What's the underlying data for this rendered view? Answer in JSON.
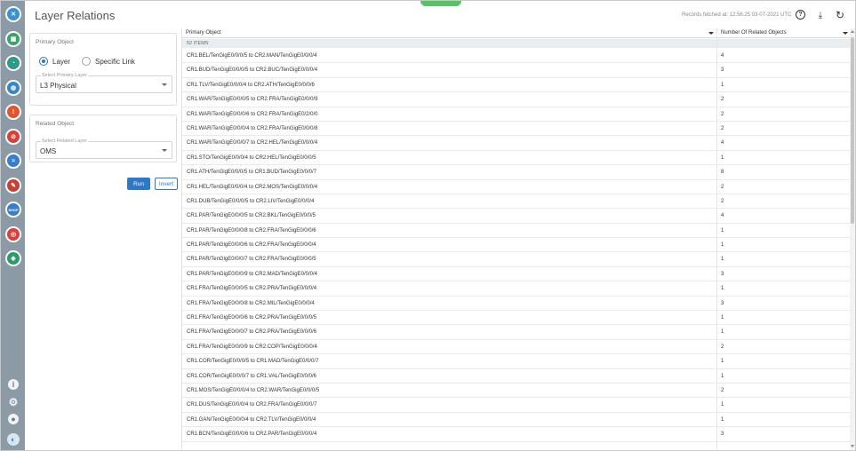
{
  "header": {
    "title": "Layer Relations",
    "records_fetched": "Records fetched at: 12:56:25 03-07-2021 UTC"
  },
  "rail_icons": [
    {
      "name": "logo-icon",
      "color": "#3a8fd6",
      "glyph": "✕"
    },
    {
      "name": "document-icon",
      "color": "#3aa36b",
      "glyph": "▣"
    },
    {
      "name": "gauge-icon",
      "color": "#2d9a8a",
      "glyph": "◔"
    },
    {
      "name": "globe-icon",
      "color": "#3a84c8",
      "glyph": "◍"
    },
    {
      "name": "alert-icon",
      "color": "#e0552e",
      "glyph": "!"
    },
    {
      "name": "no-entry-icon",
      "color": "#d8403a",
      "glyph": "⊘"
    },
    {
      "name": "wave-icon",
      "color": "#3a7dc8",
      "glyph": "≈"
    },
    {
      "name": "tools-icon",
      "color": "#c8403a",
      "glyph": "✎"
    },
    {
      "name": "shop-icon",
      "color": "#3a7dc8",
      "glyph": "SHOP"
    },
    {
      "name": "radar-icon",
      "color": "#d8403a",
      "glyph": "◎"
    },
    {
      "name": "layers-icon",
      "color": "#2d9a6b",
      "glyph": "◈"
    }
  ],
  "primary_panel": {
    "title": "Primary Object",
    "option_layer": "Layer",
    "option_link": "Specific Link",
    "select_label": "Select Primary Layer",
    "select_value": "L3 Physical"
  },
  "related_panel": {
    "title": "Related Object",
    "select_label": "Select Related Layer",
    "select_value": "OMS"
  },
  "buttons": {
    "run": "Run",
    "invert": "Invert"
  },
  "table": {
    "col_primary": "Primary Object",
    "col_count": "Number Of Related Objects",
    "items_label": "52 ITEMS",
    "rows": [
      {
        "primary": "CR1.BEL/TenGigE0/0/0/5 to CR2.MAN/TenGigE0/0/0/4",
        "count": "4"
      },
      {
        "primary": "CR1.BUD/TenGigE0/0/0/5 to CR2.BUC/TenGigE0/0/0/4",
        "count": "3"
      },
      {
        "primary": "CR1.TLV/TenGigE0/0/0/4 to CR2.ATH/TenGigE0/0/0/6",
        "count": "1"
      },
      {
        "primary": "CR1.WAR/TenGigE0/0/0/5 to CR2.FRA/TenGigE0/0/0/9",
        "count": "2"
      },
      {
        "primary": "CR1.WAR/TenGigE0/0/0/6 to CR2.FRA/TenGigE0/2/0/0",
        "count": "2"
      },
      {
        "primary": "CR1.WAR/TenGigE0/0/0/4 to CR2.FRA/TenGigE0/0/0/8",
        "count": "2"
      },
      {
        "primary": "CR1.WAR/TenGigE0/0/0/7 to CR2.HEL/TenGigE0/0/0/4",
        "count": "4"
      },
      {
        "primary": "CR1.STO/TenGigE0/0/0/4 to CR2.HEL/TenGigE0/0/0/5",
        "count": "1"
      },
      {
        "primary": "CR1.ATH/TenGigE0/0/0/5 to CR1.BUD/TenGigE0/0/0/7",
        "count": "8"
      },
      {
        "primary": "CR1.HEL/TenGigE0/0/0/4 to CR2.MOS/TenGigE0/0/0/4",
        "count": "2"
      },
      {
        "primary": "CR1.DUB/TenGigE0/0/0/5 to CR2.LIV/TenGigE0/0/0/4",
        "count": "2"
      },
      {
        "primary": "CR1.PAR/TenGigE0/0/0/5 to CR2.BKL/TenGigE0/0/0/5",
        "count": "4"
      },
      {
        "primary": "CR1.PAR/TenGigE0/0/0/8 to CR2.FRA/TenGigE0/0/0/6",
        "count": "1"
      },
      {
        "primary": "CR1.PAR/TenGigE0/0/0/6 to CR2.FRA/TenGigE0/0/0/4",
        "count": "1"
      },
      {
        "primary": "CR1.PAR/TenGigE0/0/0/7 to CR2.FRA/TenGigE0/0/0/5",
        "count": "1"
      },
      {
        "primary": "CR1.PAR/TenGigE0/0/0/9 to CR2.MAD/TenGigE0/0/0/4",
        "count": "3"
      },
      {
        "primary": "CR1.FRA/TenGigE0/0/0/5 to CR2.PRA/TenGigE0/0/0/4",
        "count": "1"
      },
      {
        "primary": "CR1.FRA/TenGigE0/0/0/8 to CR2.MIL/TenGigE0/0/0/4",
        "count": "3"
      },
      {
        "primary": "CR1.FRA/TenGigE0/0/0/6 to CR2.PRA/TenGigE0/0/0/5",
        "count": "1"
      },
      {
        "primary": "CR1.FRA/TenGigE0/0/0/7 to CR2.PRA/TenGigE0/0/0/6",
        "count": "1"
      },
      {
        "primary": "CR1.FRA/TenGigE0/0/0/9 to CR2.COP/TenGigE0/0/0/4",
        "count": "2"
      },
      {
        "primary": "CR1.COR/TenGigE0/0/0/5 to CR1.MAD/TenGigE0/0/0/7",
        "count": "1"
      },
      {
        "primary": "CR1.COR/TenGigE0/0/0/7 to CR1.VAL/TenGigE0/0/0/6",
        "count": "1"
      },
      {
        "primary": "CR1.MOS/TenGigE0/0/0/4 to CR2.WAR/TenGigE0/0/0/5",
        "count": "2"
      },
      {
        "primary": "CR1.DUS/TenGigE0/0/0/4 to CR2.FRA/TenGigE0/0/0/7",
        "count": "1"
      },
      {
        "primary": "CR1.GAN/TenGigE0/0/0/4 to CR2.TLV/TenGigE0/0/0/4",
        "count": "1"
      },
      {
        "primary": "CR1.BCN/TenGigE0/0/0/6 to CR2.PAR/TenGigE0/0/0/4",
        "count": "3"
      }
    ]
  },
  "colors": {
    "accent": "#2f78c4",
    "rail": "#8c9aa6",
    "top_tab": "#58c264"
  }
}
